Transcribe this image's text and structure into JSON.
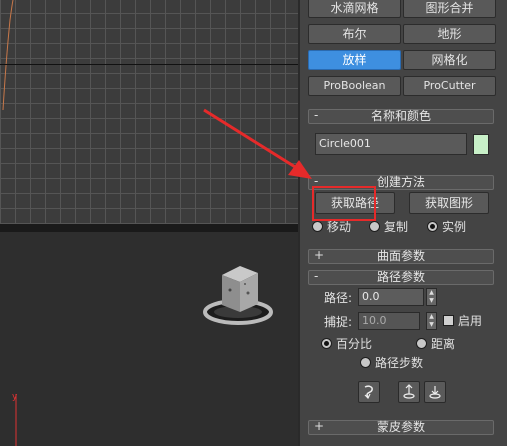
{
  "object_buttons": [
    {
      "label": "水滴网格",
      "active": false
    },
    {
      "label": "图形合并",
      "active": false
    },
    {
      "label": "布尔",
      "active": false
    },
    {
      "label": "地形",
      "active": false
    },
    {
      "label": "放样",
      "active": true
    },
    {
      "label": "网格化",
      "active": false
    },
    {
      "label": "ProBoolean",
      "active": false
    },
    {
      "label": "ProCutter",
      "active": false
    }
  ],
  "name_color": {
    "title": "名称和颜色",
    "toggle": "-",
    "object_name": "Circle001",
    "color": "#c8f0c8"
  },
  "creation_method": {
    "title": "创建方法",
    "toggle": "-",
    "get_path_label": "获取路径",
    "get_shape_label": "获取图形",
    "move_label": "移动",
    "copy_label": "复制",
    "instance_label": "实例",
    "selected": "instance"
  },
  "surface_params": {
    "title": "曲面参数",
    "toggle": "+"
  },
  "path_params": {
    "title": "路径参数",
    "toggle": "-",
    "path_label": "路径:",
    "path_value": "0.0",
    "snap_label": "捕捉:",
    "snap_value": "10.0",
    "enable_label": "启用",
    "percentage_label": "百分比",
    "distance_label": "距离",
    "path_steps_label": "路径步数",
    "selected": "percentage"
  },
  "skin_params": {
    "title": "蒙皮参数",
    "toggle": "+"
  },
  "viewport": {
    "axis_label": "y"
  },
  "colors": {
    "accent_active": "#3e8fe0",
    "annotation": "#e62a2a"
  }
}
